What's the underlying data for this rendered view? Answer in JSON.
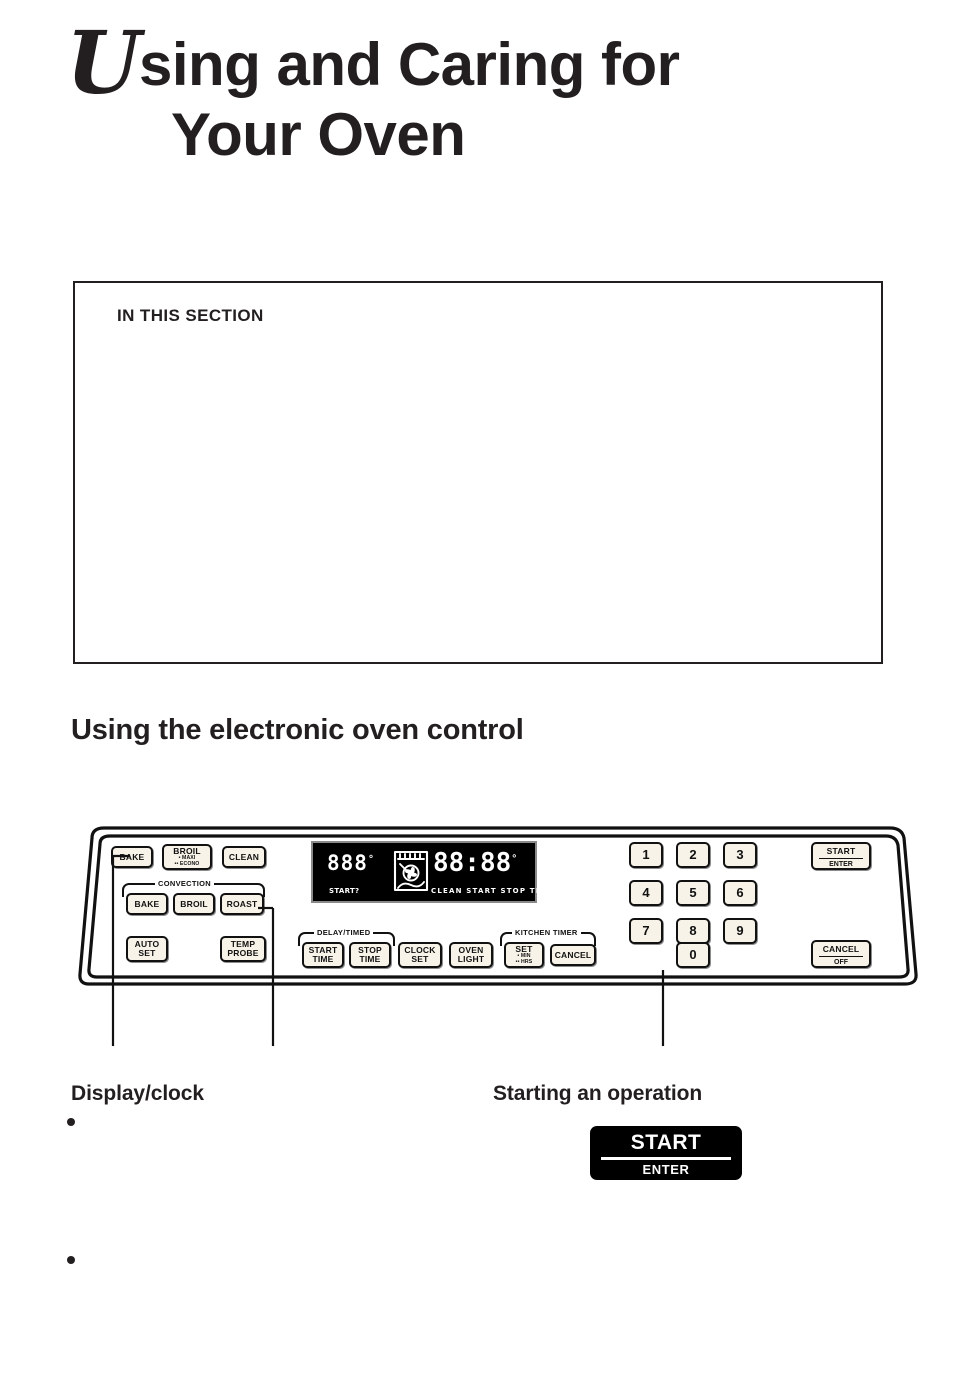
{
  "title": {
    "dropcap": "U",
    "line1_rest": "sing and Caring for",
    "line2": "Your Oven"
  },
  "section_box": {
    "heading": "IN THIS SECTION",
    "items": []
  },
  "section_heading": "Using the electronic oven control",
  "control_panel": {
    "display": {
      "temp_digits": "888",
      "temp_degree": "°",
      "clock_digits": "88:88",
      "clock_degree": "°",
      "start_prompt": "START?",
      "indicators": "CLEAN START STOP TIMER",
      "convection_icon": "convection-fan-icon"
    },
    "left_keys": [
      {
        "name": "bake",
        "label": "BAKE"
      },
      {
        "name": "broil",
        "label": "BROIL",
        "sub1": "• MAXI",
        "sub2": "•• ECONO"
      },
      {
        "name": "clean",
        "label": "CLEAN"
      }
    ],
    "convection_group": {
      "label": "CONVECTION",
      "keys": [
        {
          "name": "convection-bake",
          "label": "BAKE"
        },
        {
          "name": "convection-broil",
          "label": "BROIL"
        },
        {
          "name": "convection-roast",
          "label": "ROAST"
        }
      ]
    },
    "auto_set": {
      "line1": "AUTO",
      "line2": "SET"
    },
    "temp_probe": {
      "line1": "TEMP",
      "line2": "PROBE"
    },
    "delay_timed_group": {
      "label": "DELAY/TIMED",
      "keys": [
        {
          "name": "start-time",
          "line1": "START",
          "line2": "TIME"
        },
        {
          "name": "stop-time",
          "line1": "STOP",
          "line2": "TIME"
        }
      ]
    },
    "clock_set": {
      "line1": "CLOCK",
      "line2": "SET"
    },
    "oven_light": {
      "line1": "OVEN",
      "line2": "LIGHT"
    },
    "kitchen_timer_group": {
      "label": "KITCHEN TIMER",
      "set": {
        "label": "SET",
        "sub1": "• MIN",
        "sub2": "•• HRS"
      },
      "cancel": {
        "label": "CANCEL"
      }
    },
    "keypad": [
      "1",
      "2",
      "3",
      "4",
      "5",
      "6",
      "7",
      "8",
      "9",
      "0"
    ],
    "start_enter": {
      "line1": "START",
      "line2": "ENTER"
    },
    "cancel_off": {
      "line1": "CANCEL",
      "line2": "OFF"
    }
  },
  "captions": {
    "display_clock": "Display/clock",
    "starting_operation": "Starting an operation"
  },
  "start_button_illustration": {
    "start": "START",
    "enter": "ENTER"
  },
  "colors": {
    "ink": "#231f20",
    "key_face": "#f7f3e8",
    "display_bg": "#000000",
    "display_text": "#ffffff"
  }
}
